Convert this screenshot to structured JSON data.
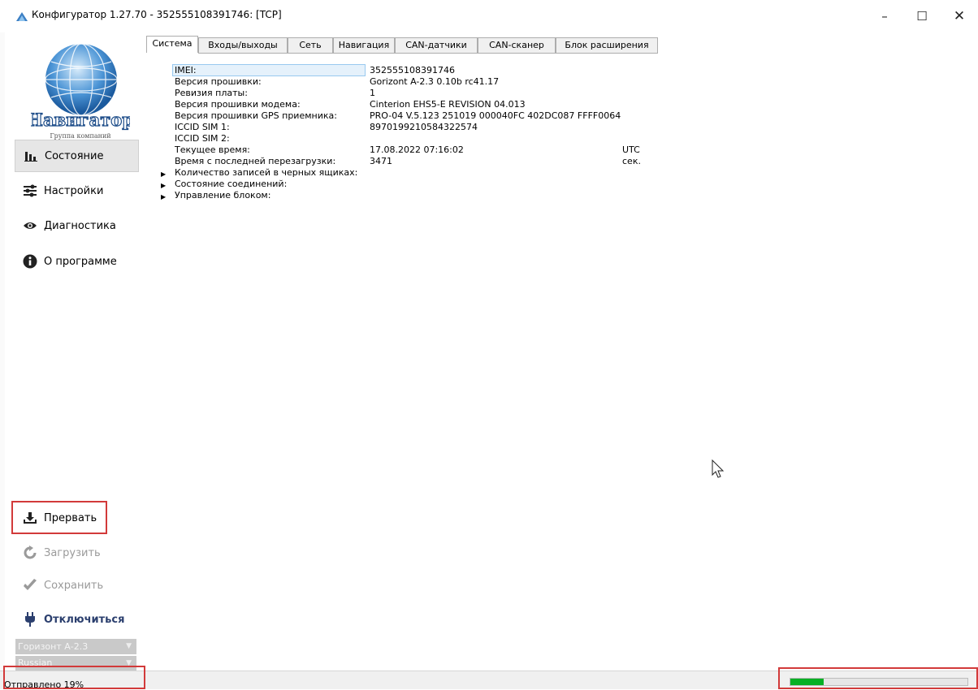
{
  "window": {
    "title": "Конфигуратор 1.27.70 - 352555108391746: [TCP]",
    "controls": {
      "minimize": "–",
      "maximize": "☐",
      "close": "✕"
    }
  },
  "sidebar": {
    "logo_text": "Навигатор",
    "logo_subtext": "Группа компаний",
    "nav": [
      {
        "label": "Состояние",
        "icon": "bar-chart-icon",
        "active": true
      },
      {
        "label": "Настройки",
        "icon": "sliders-icon",
        "active": false
      },
      {
        "label": "Диагностика",
        "icon": "eye-icon",
        "active": false
      },
      {
        "label": "О программе",
        "icon": "info-icon",
        "active": false
      }
    ],
    "actions": {
      "abort": "Прервать",
      "load": "Загрузить",
      "save": "Сохранить",
      "disconnect": "Отключиться"
    },
    "device_select": "Горизонт А-2.3",
    "language_select": "Russian"
  },
  "tabs": [
    "Система",
    "Входы/выходы",
    "Сеть",
    "Навигация",
    "CAN-датчики",
    "CAN-сканер",
    "Блок расширения"
  ],
  "active_tab": "Система",
  "system": {
    "rows": [
      {
        "label": "IMEI:",
        "value": "352555108391746",
        "unit": ""
      },
      {
        "label": "Версия прошивки:",
        "value": "Gorizont A-2.3 0.10b rc41.17",
        "unit": ""
      },
      {
        "label": "Ревизия платы:",
        "value": "1",
        "unit": ""
      },
      {
        "label": "Версия прошивки модема:",
        "value": "Cinterion  EHS5-E  REVISION 04.013",
        "unit": ""
      },
      {
        "label": "Версия прошивки GPS приемника:",
        "value": "PRO-04 V.5.123 251019 000040FC 402DC087 FFFF0064",
        "unit": ""
      },
      {
        "label": "ICCID SIM 1:",
        "value": "8970199210584322574",
        "unit": ""
      },
      {
        "label": "ICCID SIM 2:",
        "value": "",
        "unit": ""
      },
      {
        "label": "Текущее время:",
        "value": "17.08.2022 07:16:02",
        "unit": "UTC"
      },
      {
        "label": "Время с последней перезагрузки:",
        "value": "3471",
        "unit": "сек."
      }
    ],
    "groups": [
      "Количество записей в черных ящиках:",
      "Состояние соединений:",
      "Управление блоком:"
    ]
  },
  "status": {
    "text": "Отправлено 19%",
    "progress_percent": 19
  },
  "colors": {
    "highlight": "#d23a3a",
    "progress": "#06b025",
    "selection": "#e5f1fb"
  }
}
